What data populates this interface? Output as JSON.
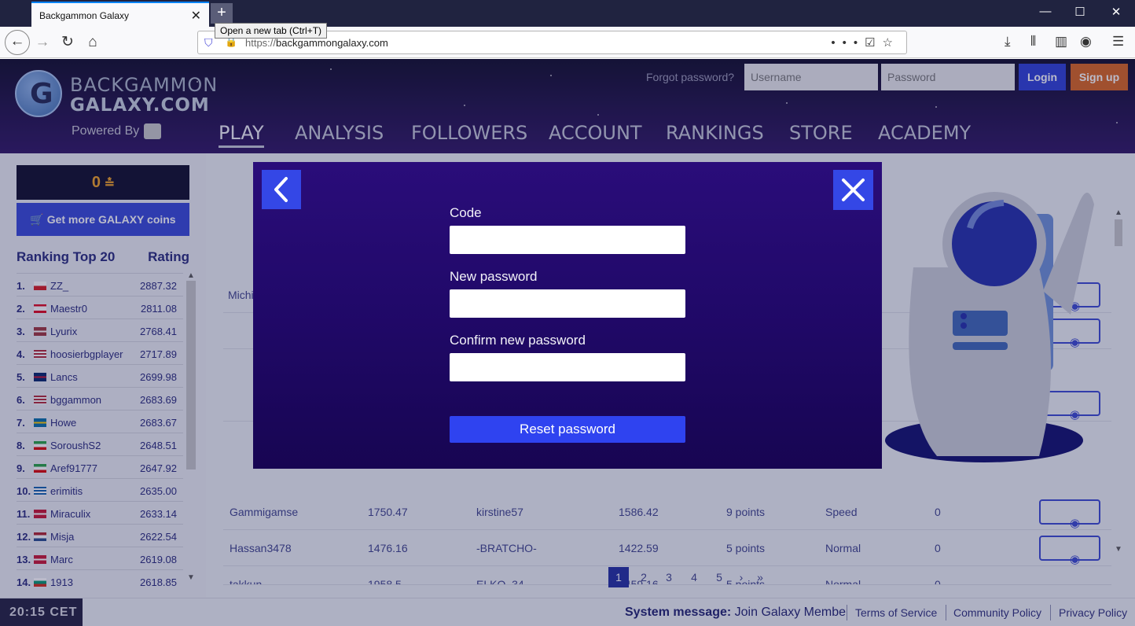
{
  "browser": {
    "tab_title": "Backgammon Galaxy",
    "tooltip": "Open a new tab (Ctrl+T)",
    "url_protocol": "https://",
    "url_host": "backgammongalaxy.com"
  },
  "header": {
    "brand_line1": "BACKGAMMON",
    "brand_line2": "GALAXY.COM",
    "powered_by": "Powered By",
    "forgot_password": "Forgot password?",
    "username_placeholder": "Username",
    "password_placeholder": "Password",
    "login_label": "Login",
    "signup_label": "Sign up",
    "nav": [
      "PLAY",
      "ANALYSIS",
      "FOLLOWERS",
      "ACCOUNT",
      "RANKINGS",
      "STORE",
      "ACADEMY"
    ],
    "active_nav": "PLAY"
  },
  "sidebar": {
    "coins_value": "0",
    "get_coins_label": "Get more GALAXY coins",
    "ranking_title": "Ranking Top 20",
    "rating_title": "Rating",
    "rankings": [
      {
        "num": "1.",
        "name": "ZZ_",
        "score": "2887.32",
        "flag": "cz"
      },
      {
        "num": "2.",
        "name": "Maestr0",
        "score": "2811.08",
        "flag": "lb"
      },
      {
        "num": "3.",
        "name": "Lyurix",
        "score": "2768.41",
        "flag": "lv"
      },
      {
        "num": "4.",
        "name": "hoosierbgplayer",
        "score": "2717.89",
        "flag": "us"
      },
      {
        "num": "5.",
        "name": "Lancs",
        "score": "2699.98",
        "flag": "gb"
      },
      {
        "num": "6.",
        "name": "bggammon",
        "score": "2683.69",
        "flag": "us"
      },
      {
        "num": "7.",
        "name": "Howe",
        "score": "2683.67",
        "flag": "se"
      },
      {
        "num": "8.",
        "name": "SoroushS2",
        "score": "2648.51",
        "flag": "ir"
      },
      {
        "num": "9.",
        "name": "Aref91777",
        "score": "2647.92",
        "flag": "ir"
      },
      {
        "num": "10.",
        "name": "erimitis",
        "score": "2635.00",
        "flag": "gr"
      },
      {
        "num": "11.",
        "name": "Miraculix",
        "score": "2633.14",
        "flag": "dk"
      },
      {
        "num": "12.",
        "name": "Misja",
        "score": "2622.54",
        "flag": "nl"
      },
      {
        "num": "13.",
        "name": "Marc",
        "score": "2619.08",
        "flag": "dk"
      },
      {
        "num": "14.",
        "name": "1913",
        "score": "2618.85",
        "flag": "bg"
      }
    ]
  },
  "main": {
    "rows": [
      {
        "p1": "Gammigamse",
        "r1": "1750.47",
        "p2": "kirstine57",
        "r2": "1586.42",
        "length": "9 points",
        "type": "Speed",
        "watchers": "0"
      },
      {
        "p1": "Hassan3478",
        "r1": "1476.16",
        "p2": "-BRATCHO-",
        "r2": "1422.59",
        "length": "5 points",
        "type": "Normal",
        "watchers": "0"
      },
      {
        "p1": "takkun",
        "r1": "1958.5",
        "p2": "ELKO_34",
        "r2": "1459.16",
        "length": "5 points",
        "type": "Normal",
        "watchers": "0"
      }
    ],
    "pages": [
      "1",
      "2",
      "3",
      "4",
      "5"
    ],
    "active_page": "1"
  },
  "footer": {
    "clock": "20:15 CET",
    "system_label": "System message:",
    "system_text": "Join Galaxy Members",
    "links": [
      "Terms of Service",
      "Community Policy",
      "Privacy Policy"
    ]
  },
  "modal": {
    "code_label": "Code",
    "new_password_label": "New password",
    "confirm_label": "Confirm new password",
    "reset_label": "Reset password"
  },
  "colors": {
    "accent": "#3447e6",
    "modal_bg": "#21096a",
    "signup": "#d9621b",
    "coins": "#f0a020"
  }
}
